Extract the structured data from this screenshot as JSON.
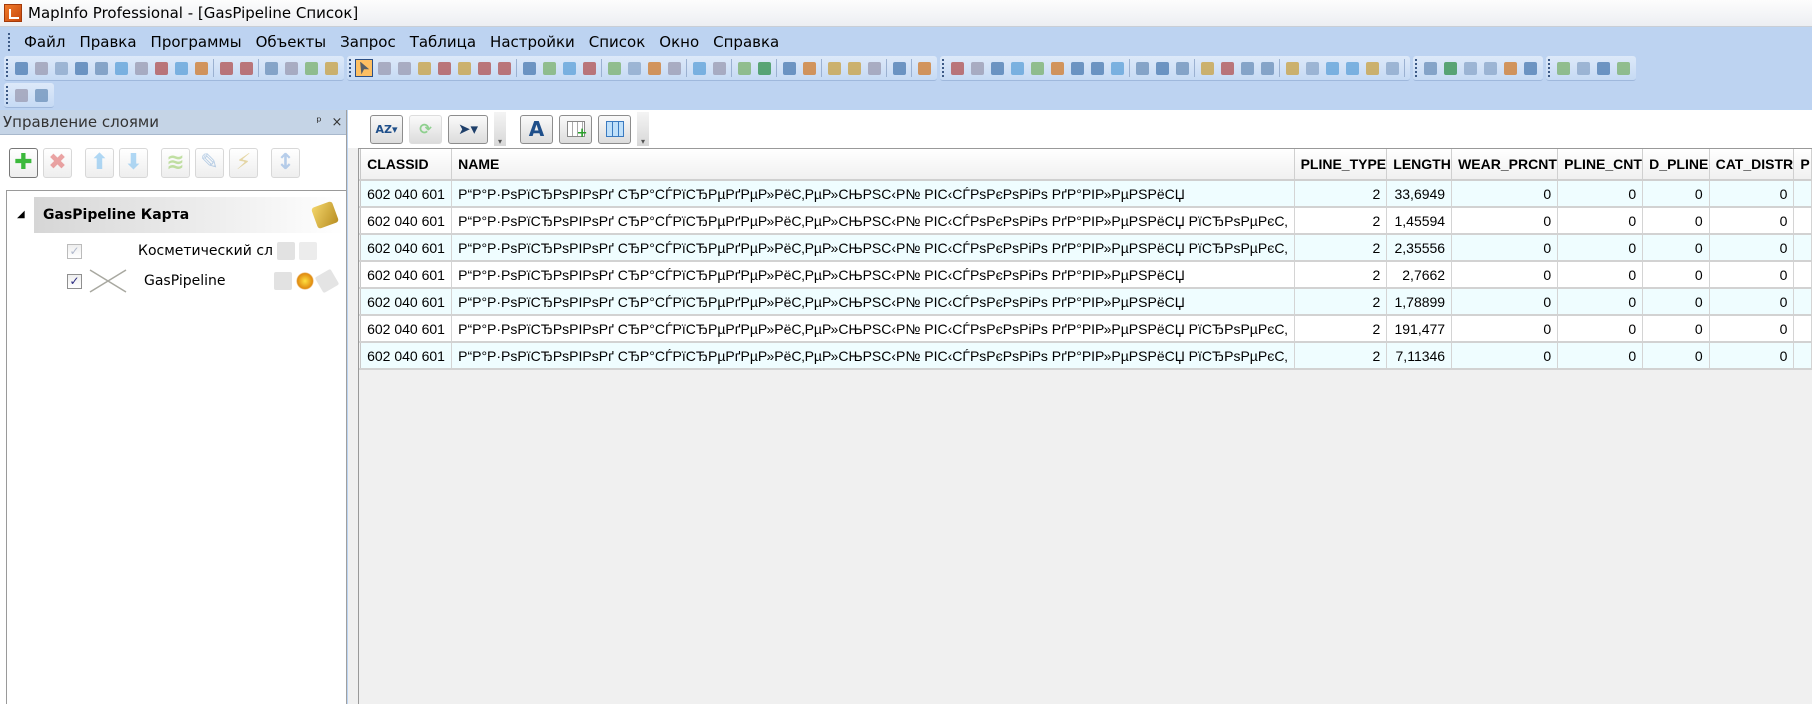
{
  "window": {
    "title": "MapInfo Professional - [GasPipeline Список]"
  },
  "menu": [
    "Файл",
    "Правка",
    "Программы",
    "Объекты",
    "Запрос",
    "Таблица",
    "Настройки",
    "Список",
    "Окно",
    "Справка"
  ],
  "toolbar1_groups": [
    [
      "symbol",
      "line",
      "polyline",
      "arc",
      "polygon",
      "ellipse",
      "rectangle",
      "rounded-rect",
      "text",
      "frame",
      "|",
      "add-node",
      "reshape",
      "|",
      "map-pin",
      "line-style",
      "region-style",
      "text-style"
    ],
    [
      "select",
      "marquee-select",
      "radius-select",
      "polygon-select",
      "boundary-select",
      "unselect-all",
      "invert-select",
      "graph-select",
      "|",
      "zoom-in",
      "zoom-out",
      "change-view",
      "grabber",
      "|",
      "info",
      "label",
      "drag-map",
      "hot-link",
      "|",
      "layer-control",
      "ruler",
      "|",
      "legend",
      "statistics",
      "|",
      "clip-region",
      "set-clip",
      "|",
      "dist-calc",
      "boundary",
      "scale",
      "|",
      "list",
      "|",
      "redistrict"
    ],
    [
      "new-table",
      "open",
      "open-workspace",
      "open-dbms",
      "open-universal",
      "close-all",
      "save-table",
      "save-copy",
      "save-workspace",
      "|",
      "new-browser",
      "print",
      "print-pdf",
      "|",
      "cut",
      "copy",
      "paste",
      "undo",
      "|",
      "new-browser-window",
      "new-mapper",
      "new-grapher",
      "new-layout",
      "new-redistrict",
      "new-3d",
      "|"
    ],
    [
      "run-program",
      "tool-manager",
      "mapbasic",
      "catalog",
      "universal-translator",
      "eye-dropper"
    ],
    [
      "open-gis",
      "world-map",
      "help",
      "graph"
    ]
  ],
  "toolbar2_icons": [
    "legend-designer",
    "properties"
  ],
  "layer_panel": {
    "title": "Управление слоями",
    "pin": "ᵖ",
    "close": "×",
    "tools": [
      "add-layer",
      "remove-layer",
      "move-up",
      "move-down",
      "layer-properties",
      "style-override",
      "label-override",
      "layer-reorder"
    ],
    "map_name": "GasPipeline Карта",
    "layers": [
      {
        "name": "Косметический сл",
        "checked": true,
        "enabled": false
      },
      {
        "name": "GasPipeline",
        "checked": true,
        "enabled": true
      }
    ]
  },
  "browser": {
    "tools": [
      "sort-filter",
      "refresh",
      "select-tool",
      "text-style",
      "add-row",
      "pick-fields"
    ],
    "columns": [
      "CLASSID",
      "NAME",
      "PLINE_TYPE",
      "LENGTH",
      "WEAR_PRCNT",
      "PLINE_CNT",
      "D_PLINE",
      "CAT_DISTR",
      "P"
    ],
    "rows": [
      [
        "602 040 601",
        "Р“Р°Р·РѕРїСЂРѕРІРѕРґ СЂР°СЃРїСЂРµРґРµР»РёС‚РµР»СЊРЅС‹Р№ РІС‹СЃРѕРєРѕРіРѕ РґР°РІР»РµРЅРёСЏ",
        "2",
        "33,6949",
        "0",
        "0",
        "0",
        "0",
        ""
      ],
      [
        "602 040 601",
        "Р“Р°Р·РѕРїСЂРѕРІРѕРґ СЂР°СЃРїСЂРµРґРµР»РёС‚РµР»СЊРЅС‹Р№ РІС‹СЃРѕРєРѕРіРѕ РґР°РІР»РµРЅРёСЏ РїСЂРѕРµРєС‚",
        "2",
        "1,45594",
        "0",
        "0",
        "0",
        "0",
        ""
      ],
      [
        "602 040 601",
        "Р“Р°Р·РѕРїСЂРѕРІРѕРґ СЂР°СЃРїСЂРµРґРµР»РёС‚РµР»СЊРЅС‹Р№ РІС‹СЃРѕРєРѕРіРѕ РґР°РІР»РµРЅРёСЏ РїСЂРѕРµРєС‚",
        "2",
        "2,35556",
        "0",
        "0",
        "0",
        "0",
        ""
      ],
      [
        "602 040 601",
        "Р“Р°Р·РѕРїСЂРѕРІРѕРґ СЂР°СЃРїСЂРµРґРµР»РёС‚РµР»СЊРЅС‹Р№ РІС‹СЃРѕРєРѕРіРѕ РґР°РІР»РµРЅРёСЏ",
        "2",
        "2,7662",
        "0",
        "0",
        "0",
        "0",
        ""
      ],
      [
        "602 040 601",
        "Р“Р°Р·РѕРїСЂРѕРІРѕРґ СЂР°СЃРїСЂРµРґРµР»РёС‚РµР»СЊРЅС‹Р№ РІС‹СЃРѕРєРѕРіРѕ РґР°РІР»РµРЅРёСЏ",
        "2",
        "1,78899",
        "0",
        "0",
        "0",
        "0",
        ""
      ],
      [
        "602 040 601",
        "Р“Р°Р·РѕРїСЂРѕРІРѕРґ СЂР°СЃРїСЂРµРґРµР»РёС‚РµР»СЊРЅС‹Р№ РІС‹СЃРѕРєРѕРіРѕ РґР°РІР»РµРЅРёСЏ РїСЂРѕРµРєС‚",
        "2",
        "191,477",
        "0",
        "0",
        "0",
        "0",
        ""
      ],
      [
        "602 040 601",
        "Р“Р°Р·РѕРїСЂРѕРІРѕРґ СЂР°СЃРїСЂРµРґРµР»РёС‚РµР»СЊРЅС‹Р№ РІС‹СЃРѕРєРѕРіРѕ РґР°РІР»РµРЅРёСЏ РїСЂРѕРµРєС‚",
        "2",
        "7,11346",
        "0",
        "0",
        "0",
        "0",
        ""
      ]
    ],
    "row_colors": {
      "alt": "#effdff",
      "plain": "#ffffff"
    }
  },
  "colors": {
    "menubar": "#bdd3f1",
    "active_tool": "#fdbf62",
    "add": "#3cb93c",
    "remove": "#e06a6a"
  }
}
